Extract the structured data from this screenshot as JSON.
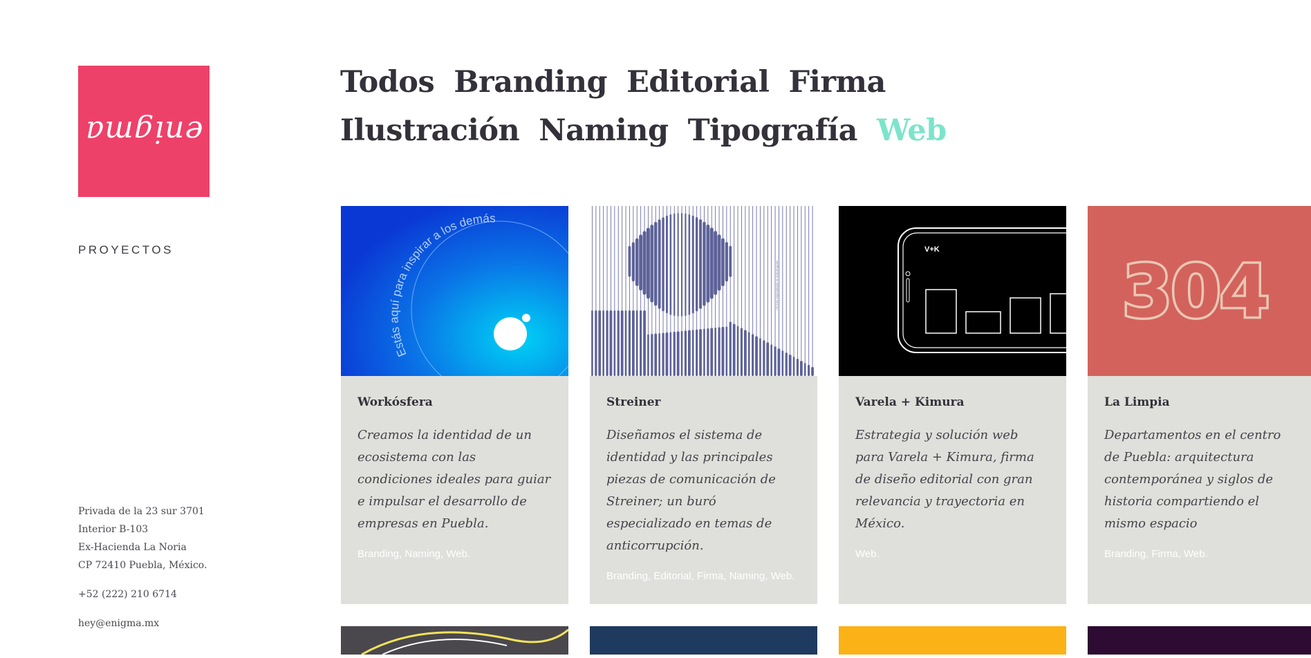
{
  "brand": {
    "logo_text": "enigma",
    "logo_color": "#ee416a"
  },
  "sidebar": {
    "projects_label": "PROYECTOS"
  },
  "contact": {
    "address_lines": [
      "Privada de la 23 sur 3701",
      "Interior B-103",
      "Ex-Hacienda La Noria",
      "CP 72410 Puebla, México."
    ],
    "phone": "+52 (222) 210 6714",
    "email": "hey@enigma.mx"
  },
  "filters": {
    "row1": [
      "Todos",
      "Branding",
      "Editorial",
      "Firma"
    ],
    "row2": [
      "Ilustración",
      "Naming",
      "Tipografía",
      "Web"
    ],
    "active": "Web",
    "active_color": "#7de4ca"
  },
  "projects": [
    {
      "title": "Workósfera",
      "description": "Creamos la identidad de un ecosistema con las condiciones ideales para guiar e impulsar el desarrollo de empresas en Puebla.",
      "tags": "Branding, Naming, Web.",
      "image_text": "Estás aquí para inspirar a los demás"
    },
    {
      "title": "Streiner",
      "description": "Diseñamos el sistema de identidad y las principales piezas de comunicación de Streiner; un buró especializado en temas de anticorrupción.",
      "tags": "Branding, Editorial, Firma, Naming, Web.",
      "image_text": "Un buró especializado en anticorrupción"
    },
    {
      "title": "Varela + Kimura",
      "description": "Estrategia y solución web para Varela + Kimura, firma de diseño editorial con gran relevancia y trayectoria en México.",
      "tags": "Web.",
      "image_text": "V+K"
    },
    {
      "title": "La Limpia",
      "description": "Departamentos en el centro de Puebla: arquitectura contemporánea y siglos de historia compartiendo el mismo espacio",
      "tags": "Branding, Firma, Web.",
      "image_text": "304"
    }
  ],
  "next_row_colors": [
    "#4a484d",
    "#1f3a5f",
    "#fbb217",
    "#2e0b33"
  ]
}
